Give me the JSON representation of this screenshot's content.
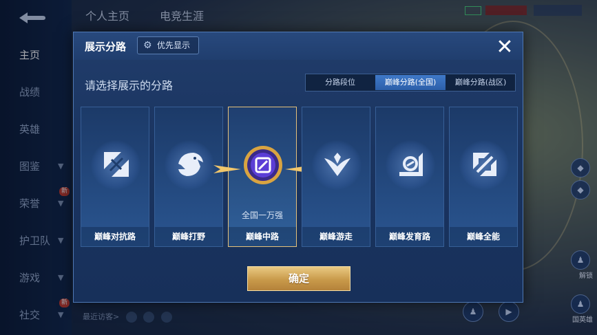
{
  "background": {
    "back_icon": "back-arrow-icon",
    "top_tabs": [
      "个人主页",
      "电竞生涯"
    ],
    "sidebar": [
      {
        "label": "主页",
        "active": true,
        "chevron": false,
        "new": false
      },
      {
        "label": "战绩",
        "active": false,
        "chevron": false,
        "new": false
      },
      {
        "label": "英雄",
        "active": false,
        "chevron": false,
        "new": false
      },
      {
        "label": "图鉴",
        "active": false,
        "chevron": true,
        "new": false
      },
      {
        "label": "荣誉",
        "active": false,
        "chevron": true,
        "new": true
      },
      {
        "label": "护卫队",
        "active": false,
        "chevron": true,
        "new": false
      },
      {
        "label": "游戏",
        "active": false,
        "chevron": true,
        "new": false
      },
      {
        "label": "社交",
        "active": false,
        "chevron": true,
        "new": true
      }
    ],
    "new_tag": "新",
    "recent_visitors": "最近访客>",
    "right_labels": [
      "解锁",
      "国英雄"
    ]
  },
  "modal": {
    "title": "展示分路",
    "priority_chip": "优先显示",
    "close_icon": "close-icon",
    "subtitle": "请选择展示的分路",
    "segments": [
      {
        "label": "分路段位",
        "active": false
      },
      {
        "label": "巅峰分路(全国)",
        "active": true
      },
      {
        "label": "巅峰分路(战区)",
        "active": false
      }
    ],
    "cards": [
      {
        "label": "巅峰对抗路",
        "icon": "clash-lane-icon",
        "selected": false,
        "rank": ""
      },
      {
        "label": "巅峰打野",
        "icon": "jungle-icon",
        "selected": false,
        "rank": ""
      },
      {
        "label": "巅峰中路",
        "icon": "mid-lane-badge-icon",
        "selected": true,
        "rank": "全国一万强"
      },
      {
        "label": "巅峰游走",
        "icon": "roam-icon",
        "selected": false,
        "rank": ""
      },
      {
        "label": "巅峰发育路",
        "icon": "farm-lane-icon",
        "selected": false,
        "rank": ""
      },
      {
        "label": "巅峰全能",
        "icon": "all-round-icon",
        "selected": false,
        "rank": ""
      }
    ],
    "confirm_label": "确定"
  },
  "colors": {
    "accent_blue": "#3f79c9",
    "gold": "#e7c27a",
    "modal_bg": "#1a3460"
  }
}
